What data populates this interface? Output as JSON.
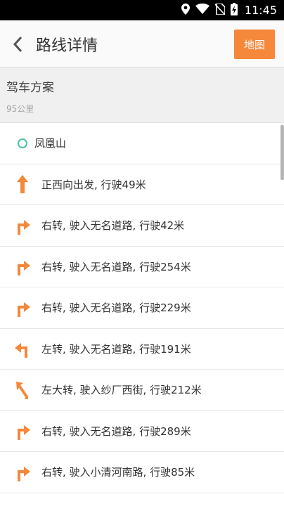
{
  "status_bar": {
    "time": "11:45",
    "icons": [
      "location-icon",
      "wifi-icon",
      "no-sim-icon",
      "battery-charging-icon"
    ]
  },
  "app_bar": {
    "title": "路线详情",
    "back_icon": "chevron-left-icon",
    "map_button": "地图"
  },
  "summary": {
    "title": "驾车方案",
    "distance": "95公里"
  },
  "colors": {
    "accent": "#f5883a",
    "origin_circle": "#4fbfa8",
    "arrow": "#f5883a"
  },
  "steps": [
    {
      "icon": "origin-circle-icon",
      "text": "凤凰山"
    },
    {
      "icon": "straight-arrow-icon",
      "text": "正西向出发, 行驶49米"
    },
    {
      "icon": "turn-right-icon",
      "text": "右转, 驶入无名道路, 行驶42米"
    },
    {
      "icon": "turn-right-icon",
      "text": "右转, 驶入无名道路, 行驶254米"
    },
    {
      "icon": "turn-right-icon",
      "text": "右转, 驶入无名道路, 行驶229米"
    },
    {
      "icon": "turn-left-icon",
      "text": "左转, 驶入无名道路, 行驶191米"
    },
    {
      "icon": "sharp-left-icon",
      "text": "左大转, 驶入纱厂西街, 行驶212米"
    },
    {
      "icon": "turn-right-icon",
      "text": "右转, 驶入无名道路, 行驶289米"
    },
    {
      "icon": "turn-right-icon",
      "text": "右转, 驶入小清河南路, 行驶85米"
    }
  ]
}
